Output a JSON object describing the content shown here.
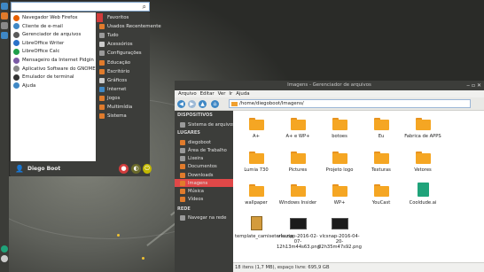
{
  "menu": {
    "search_value": "",
    "apps": [
      {
        "label": "Navegador Web Firefox",
        "color": "#e66000"
      },
      {
        "label": "Cliente de e-mail",
        "color": "#3f88c5"
      },
      {
        "label": "Gerenciador de arquivos",
        "color": "#5a5a5a"
      },
      {
        "label": "LibreOffice Writer",
        "color": "#2a72c9"
      },
      {
        "label": "LibreOffice Calc",
        "color": "#1e9e4a"
      },
      {
        "label": "Mensageiro da Internet Pidgin",
        "color": "#7a5aa5"
      },
      {
        "label": "Aplicativo Software do GNOME",
        "color": "#888888"
      },
      {
        "label": "Emulador de terminal",
        "color": "#333333"
      },
      {
        "label": "Ajuda",
        "color": "#3f88c5"
      }
    ],
    "categories": [
      {
        "label": "Favoritos",
        "color": "#d23c3c"
      },
      {
        "label": "Usados Recentemente",
        "color": "#e07b2c"
      },
      {
        "label": "Tudo",
        "color": "#9a9a9a"
      },
      {
        "label": "Acessórios",
        "color": "#cccccc"
      },
      {
        "label": "Configurações",
        "color": "#9a9a9a"
      },
      {
        "label": "Educação",
        "color": "#e07b2c"
      },
      {
        "label": "Escritório",
        "color": "#e07b2c"
      },
      {
        "label": "Gráficos",
        "color": "#cccccc"
      },
      {
        "label": "Internet",
        "color": "#3f88c5"
      },
      {
        "label": "Jogos",
        "color": "#e07b2c"
      },
      {
        "label": "Multimídia",
        "color": "#e07b2c"
      },
      {
        "label": "Sistema",
        "color": "#e07b2c"
      }
    ],
    "user_name": "Diego Boot"
  },
  "filemanager": {
    "title": "Imagens - Gerenciador de arquivos",
    "menubar": [
      "Arquivo",
      "Editar",
      "Ver",
      "Ir",
      "Ajuda"
    ],
    "location": "/home/diegoboot/Imagens/",
    "sidebar": {
      "devices_header": "DISPOSITIVOS",
      "devices": [
        "Sistema de arquivos"
      ],
      "places_header": "LUGARES",
      "places": [
        "diegoboot",
        "Área de Trabalho",
        "Lixeira",
        "Documentos",
        "Downloads",
        "Imagens",
        "Música",
        "Vídeos"
      ],
      "network_header": "REDE",
      "network": [
        "Navegar na rede"
      ]
    },
    "items": [
      {
        "label": "A+",
        "kind": "folder"
      },
      {
        "label": "A+ e WP+",
        "kind": "folder"
      },
      {
        "label": "botoes",
        "kind": "folder"
      },
      {
        "label": "Eu",
        "kind": "folder"
      },
      {
        "label": "Fabrica de APPS",
        "kind": "folder"
      },
      {
        "label": "Lumia 730",
        "kind": "folder"
      },
      {
        "label": "Pictures",
        "kind": "folder"
      },
      {
        "label": "Projeto logo",
        "kind": "folder"
      },
      {
        "label": "Texturas",
        "kind": "folder"
      },
      {
        "label": "Vetores",
        "kind": "folder"
      },
      {
        "label": "wallpaper",
        "kind": "folder"
      },
      {
        "label": "Windows Insider",
        "kind": "folder"
      },
      {
        "label": "WP+",
        "kind": "folder"
      },
      {
        "label": "YouCast",
        "kind": "folder"
      },
      {
        "label": "Cooldude.ai",
        "kind": "ai"
      },
      {
        "label": "template_camisetería.zip",
        "kind": "zip"
      },
      {
        "label": "vlcsnap-2016-02-07-12h13m44s63.png",
        "kind": "image"
      },
      {
        "label": "vlcsnap-2016-04-20-02h35m47s92.png",
        "kind": "image"
      }
    ],
    "status": "18 itens (1,7 MB), espaço livre: 695,9 GB"
  }
}
